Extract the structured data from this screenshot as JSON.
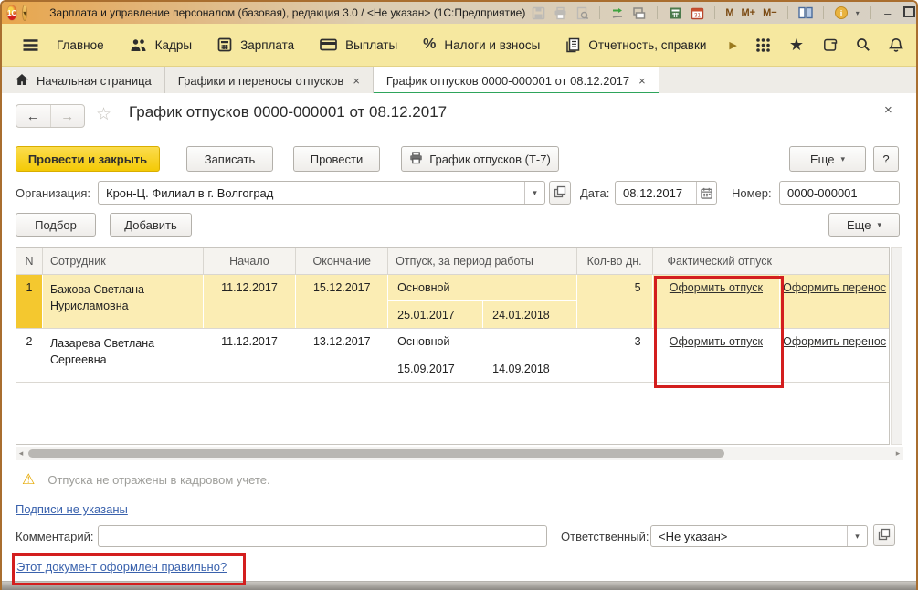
{
  "titlebar": {
    "logo": "1С",
    "title": "Зарплата и управление персоналом (базовая), редакция 3.0 / <Не указан>  (1С:Предприятие)",
    "m": "М",
    "m_plus": "М+",
    "m_minus": "М−"
  },
  "menu": {
    "items": [
      "Главное",
      "Кадры",
      "Зарплата",
      "Выплаты",
      "Налоги и взносы",
      "Отчетность, справки"
    ]
  },
  "tabs": [
    {
      "label": "Начальная страница"
    },
    {
      "label": "Графики и переносы отпусков"
    },
    {
      "label": "График отпусков 0000-000001 от 08.12.2017"
    }
  ],
  "doc": {
    "title": "График отпусков 0000-000001 от 08.12.2017",
    "toolbar": {
      "post_close": "Провести и закрыть",
      "write": "Записать",
      "post": "Провести",
      "print_t7": "График отпусков (Т-7)",
      "more": "Еще",
      "help": "?"
    },
    "fields": {
      "org_label": "Организация:",
      "org_value": "Крон-Ц. Филиал в г. Волгоград",
      "date_label": "Дата:",
      "date_value": "08.12.2017",
      "number_label": "Номер:",
      "number_value": "0000-000001"
    },
    "actions": {
      "pick": "Подбор",
      "add": "Добавить",
      "more": "Еще"
    }
  },
  "table": {
    "headers": [
      "N",
      "Сотрудник",
      "Начало",
      "Окончание",
      "Отпуск, за период работы",
      "Кол-во дн.",
      "Фактический отпуск"
    ],
    "rows": [
      {
        "n": "1",
        "employee": "Бажова Светлана Нурисламовна",
        "start": "11.12.2017",
        "end": "15.12.2017",
        "type": "Основной",
        "period_from": "25.01.2017",
        "period_to": "24.01.2018",
        "days": "5",
        "make_vacation": "Оформить отпуск",
        "make_transfer": "Оформить перенос"
      },
      {
        "n": "2",
        "employee": "Лазарева Светлана Сергеевна",
        "start": "11.12.2017",
        "end": "13.12.2017",
        "type": "Основной",
        "period_from": "15.09.2017",
        "period_to": "14.09.2018",
        "days": "3",
        "make_vacation": "Оформить отпуск",
        "make_transfer": "Оформить перенос"
      }
    ]
  },
  "footer": {
    "warning": "Отпуска не отражены в кадровом учете.",
    "signs_link": "Подписи не указаны",
    "comment_label": "Комментарий:",
    "responsible_label": "Ответственный:",
    "responsible_value": "<Не указан>",
    "check_link": "Этот документ оформлен правильно?"
  },
  "icons": {
    "close": "×",
    "dropdown": "▾",
    "back": "←",
    "forward": "→",
    "star": "☆",
    "warning": "⚠",
    "scroll_left": "◂",
    "scroll_right": "▸",
    "minimize": "–",
    "percent": "%",
    "expand": "▶",
    "favorites": "★",
    "help": "?"
  },
  "colors": {
    "accent_yellow": "#F4CA06",
    "menu_bg": "#F6E8A0",
    "highlight_red": "#D31E1E",
    "selected_row": "#FBEDB4",
    "selected_marker": "#F4C82F",
    "link_blue": "#3A62AD",
    "tab_green": "#2EA45B"
  }
}
